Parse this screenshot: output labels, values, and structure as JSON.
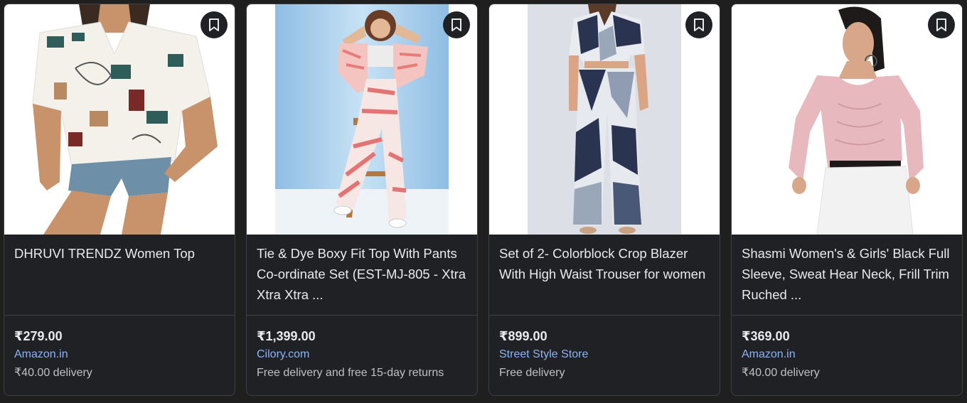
{
  "products": [
    {
      "title": "DHRUVI TRENDZ Women Top",
      "price": "₹279.00",
      "store": "Amazon.in",
      "delivery": "₹40.00 delivery",
      "image_icon": "product-photo-printed-shirt",
      "bookmark_icon": "bookmark-icon"
    },
    {
      "title": "Tie & Dye Boxy Fit Top With Pants Co-ordinate Set (EST-MJ-805 - Xtra Xtra Xtra ...",
      "price": "₹1,399.00",
      "store": "Cilory.com",
      "delivery": "Free delivery and free 15-day returns",
      "image_icon": "product-photo-tie-dye-set",
      "bookmark_icon": "bookmark-icon"
    },
    {
      "title": "Set of 2- Colorblock Crop Blazer With High Waist Trouser for women",
      "price": "₹899.00",
      "store": "Street Style Store",
      "delivery": "Free delivery",
      "image_icon": "product-photo-colorblock-set",
      "bookmark_icon": "bookmark-icon"
    },
    {
      "title": "Shasmi Women's & Girls' Black Full Sleeve, Sweat Hear Neck, Frill Trim Ruched ...",
      "price": "₹369.00",
      "store": "Amazon.in",
      "delivery": "₹40.00 delivery",
      "image_icon": "product-photo-pink-top",
      "bookmark_icon": "bookmark-icon"
    }
  ],
  "colors": {
    "page_background": "#1f1f1f",
    "card_background": "#202124",
    "store_link": "#8ab4f8",
    "text_primary": "#e8eaed",
    "text_secondary": "#bdc1c6"
  }
}
